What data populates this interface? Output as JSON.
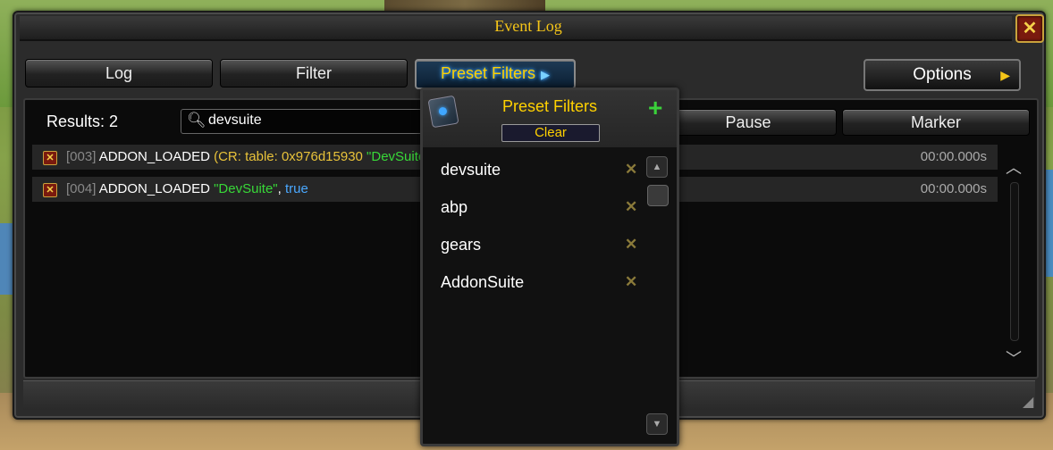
{
  "window": {
    "title": "Event Log",
    "close_glyph": "✕"
  },
  "tabs": {
    "log_label": "Log",
    "filter_label": "Filter",
    "preset_label": "Preset Filters",
    "preset_arrow": "▶"
  },
  "options": {
    "label": "Options",
    "arrow": "▶"
  },
  "toolbar": {
    "results_label": "Results: 2",
    "search_value": "devsuite",
    "search_icon": "search-icon",
    "pause_label": "Pause",
    "marker_label": "Marker"
  },
  "log": {
    "rows": [
      {
        "index": "[003]",
        "event": "ADDON_LOADED",
        "arg_prefix": "(CR: table: 0x976d15930",
        "arg_string": "\"DevSuite\"",
        "arg_sep": ", ",
        "arg_bool": "true",
        "time": "00:00.000s"
      },
      {
        "index": "[004]",
        "event": "ADDON_LOADED",
        "arg_prefix": "",
        "arg_string": "\"DevSuite\"",
        "arg_sep": ", ",
        "arg_bool": "true",
        "time": "00:00.000s"
      }
    ]
  },
  "preset_dropdown": {
    "title": "Preset Filters",
    "add_glyph": "+",
    "clear_label": "Clear",
    "remove_glyph": "✕",
    "items": [
      {
        "label": "devsuite"
      },
      {
        "label": "abp"
      },
      {
        "label": "gears"
      },
      {
        "label": "AddonSuite"
      }
    ]
  },
  "colors": {
    "title_gold": "#f5c518",
    "string_green": "#38d838",
    "bool_blue": "#4aa8ff",
    "arg_yellow": "#e8c23a"
  }
}
